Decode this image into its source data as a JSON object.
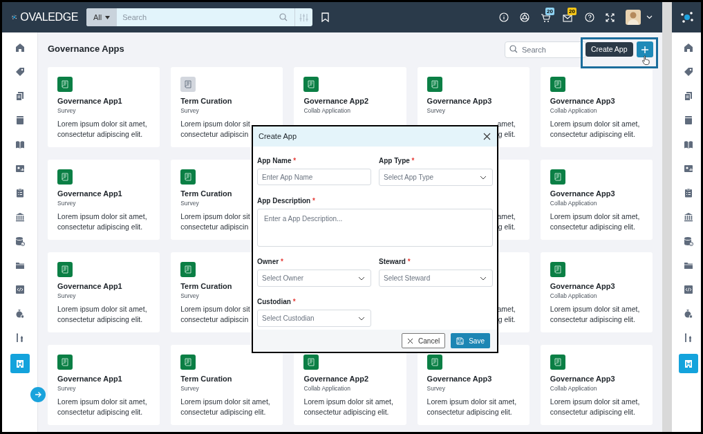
{
  "header": {
    "logo": "OVALEDGE",
    "scope": "All",
    "search_placeholder": "Search",
    "badges": [
      {
        "count": "20",
        "color": "#8fd3f4"
      },
      {
        "count": "20",
        "color": "#f5c518"
      }
    ]
  },
  "nav": [
    {
      "selected": false
    },
    {
      "selected": false
    },
    {
      "selected": false
    },
    {
      "selected": false
    },
    {
      "selected": false
    },
    {
      "selected": false
    },
    {
      "selected": false
    },
    {
      "selected": false
    },
    {
      "selected": false
    },
    {
      "selected": false
    },
    {
      "selected": false
    },
    {
      "selected": false
    },
    {
      "selected": false
    },
    {
      "selected": true
    }
  ],
  "page": {
    "title": "Governance Apps",
    "search_placeholder": "Search",
    "tooltip": "Create App"
  },
  "rows": [
    {
      "cards": [
        {
          "color": "#0b7f45",
          "title": "Governance App1",
          "subtitle": "Survey",
          "description": {
            "kind": "full",
            "lines": [
              "Lorem ipsum dolor sit amet,",
              "consectetur adipiscing elit."
            ]
          }
        },
        {
          "color": "#d3d7de",
          "title": "Term Curation",
          "subtitle": "Survey",
          "description": {
            "kind": "full",
            "lines": [
              "Lorem ipsum dolor sit",
              "consectetur adipiscin"
            ]
          }
        },
        {
          "color": "#0b7f45",
          "title": "Governance App2",
          "subtitle": "Collab Application"
        },
        {
          "color": "#0b7f45",
          "title": "Governance App3",
          "subtitle": "Survey",
          "description": {
            "kind": "covered",
            "lines": [
              "amet,",
              "g elit."
            ]
          }
        },
        {
          "color": "#0b7f45",
          "title": "Governance App3",
          "subtitle": "Collab Application",
          "description": {
            "kind": "full",
            "lines": [
              "Lorem ipsum dolor sit amet,",
              "consectetur adipiscing elit."
            ]
          }
        }
      ]
    },
    {
      "cards": [
        {
          "color": "#0b7f45",
          "title": "Governance App1",
          "subtitle": "Survey",
          "description": {
            "kind": "full",
            "lines": [
              "Lorem ipsum dolor sit amet,",
              "consectetur adipiscing elit."
            ]
          }
        },
        {
          "color": "#0b7f45",
          "title": "Term Curation",
          "subtitle": "Survey",
          "description": {
            "kind": "full",
            "lines": [
              "Lorem ipsum dolor sit",
              "consectetur adipiscin"
            ]
          }
        },
        {
          "description": {
            "kind": "covered",
            "lines": [
              "amet,",
              "g elit."
            ]
          }
        },
        {
          "color": "#0b7f45",
          "title": "Governance App3",
          "subtitle": "Collab Application",
          "description": {
            "kind": "full",
            "lines": [
              "Lorem ipsum dolor sit amet,",
              "consectetur adipiscing elit."
            ]
          }
        }
      ]
    },
    {
      "cards": [
        {
          "color": "#0b7f45",
          "title": "Governance App1",
          "subtitle": "Survey",
          "description": {
            "kind": "full",
            "lines": [
              "Lorem ipsum dolor sit amet,",
              "consectetur adipiscing elit."
            ]
          }
        },
        {
          "color": "#0b7f45",
          "title": "Term Curation",
          "subtitle": "Survey",
          "description": {
            "kind": "full",
            "lines": [
              "Lorem ipsum dolor sit",
              "consectetur adipiscin"
            ]
          }
        },
        {
          "description": {
            "kind": "covered",
            "lines": [
              "amet,",
              "g elit."
            ]
          }
        },
        {
          "color": "#0b7f45",
          "title": "Governance App3",
          "subtitle": "Collab Application",
          "description": {
            "kind": "full",
            "lines": [
              "Lorem ipsum dolor sit amet,",
              "consectetur adipiscing elit."
            ]
          }
        }
      ]
    },
    {
      "cards": [
        {
          "color": "#0b7f45",
          "title": "Governance App1",
          "subtitle": "Survey",
          "description": {
            "kind": "full",
            "lines": [
              "Lorem ipsum dolor sit amet,",
              "consectetur adipiscing elit."
            ]
          }
        },
        {
          "color": "#0b7f45",
          "title": "Term Curation",
          "subtitle": "Survey",
          "description": {
            "kind": "full",
            "lines": [
              "Lorem ipsum dolor sit amet,",
              "consectetur adipiscing elit."
            ]
          }
        },
        {
          "color": "#0b7f45",
          "title": "Governance App2",
          "subtitle": "Collab Application",
          "description": {
            "kind": "full",
            "lines": [
              "Lorem ipsum dolor sit amet,",
              "consectetur adipiscing elit."
            ]
          }
        },
        {
          "color": "#0b7f45",
          "title": "Governance App3",
          "subtitle": "Survey",
          "description": {
            "kind": "full",
            "lines": [
              "Lorem ipsum dolor sit amet,",
              "consectetur adipiscing elit."
            ]
          }
        },
        {
          "color": "#0b7f45",
          "title": "Governance App3",
          "subtitle": "Collab Application",
          "description": {
            "kind": "full",
            "lines": [
              "Lorem ipsum dolor sit amet,",
              "consectetur adipiscing elit."
            ]
          }
        }
      ]
    }
  ],
  "dialog": {
    "title": "Create App",
    "fields": [
      {
        "kind": "text",
        "label": "App Name",
        "required_mark": "*",
        "placeholder": "Enter App Name"
      },
      {
        "kind": "select",
        "label": "App Type",
        "required_mark": "*",
        "placeholder": "Select App Type"
      },
      {
        "kind": "textarea",
        "label": "App Description",
        "required_mark": "*",
        "placeholder": "Enter a App Description..."
      },
      {
        "kind": "select",
        "label": "Owner",
        "required_mark": "*",
        "placeholder": "Select Owner"
      },
      {
        "kind": "select",
        "label": "Steward",
        "required_mark": "*",
        "placeholder": "Select Steward"
      },
      {
        "kind": "select",
        "label": "Custodian",
        "required_mark": "*",
        "placeholder": "Select Custodian"
      }
    ],
    "buttons": [
      {
        "kind": "secondary",
        "label": "Cancel"
      },
      {
        "kind": "primary",
        "label": "Save"
      }
    ]
  },
  "second_window": {
    "nav": [
      {
        "selected": false
      },
      {
        "selected": false
      },
      {
        "selected": false
      },
      {
        "selected": false
      },
      {
        "selected": false
      },
      {
        "selected": false
      },
      {
        "selected": false
      },
      {
        "selected": false
      },
      {
        "selected": false
      },
      {
        "selected": false
      },
      {
        "selected": false
      },
      {
        "selected": false
      },
      {
        "selected": false
      },
      {
        "selected": true
      }
    ]
  }
}
